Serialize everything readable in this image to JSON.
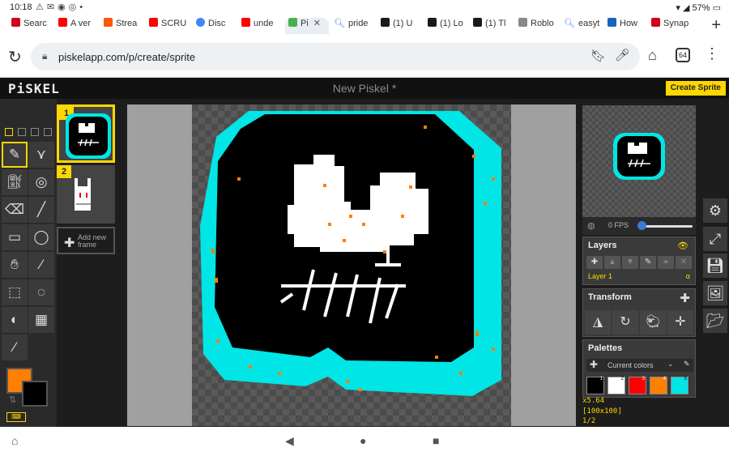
{
  "status": {
    "time": "10:18",
    "battery": "57%"
  },
  "tabs": [
    {
      "label": "Searc",
      "color": "#d0021b"
    },
    {
      "label": "A ver",
      "color": "#ff0000"
    },
    {
      "label": "Strea",
      "color": "#ff5500"
    },
    {
      "label": "SCRU",
      "color": "#ff0000"
    },
    {
      "label": "Disc",
      "color": "#4285f4"
    },
    {
      "label": "unde",
      "color": "#ff0000"
    },
    {
      "label": "Pi",
      "color": "#4caf50"
    },
    {
      "label": "pride",
      "color": "#4285f4"
    },
    {
      "label": "(1) U",
      "color": "#1a1a1a"
    },
    {
      "label": "(1) Lo",
      "color": "#1a1a1a"
    },
    {
      "label": "(1) Tl",
      "color": "#1a1a1a"
    },
    {
      "label": "Roblo",
      "color": "#888888"
    },
    {
      "label": "easyt",
      "color": "#4285f4"
    },
    {
      "label": "How",
      "color": "#1565c0"
    },
    {
      "label": "Synap",
      "color": "#d0021b"
    }
  ],
  "browser": {
    "url": "piskelapp.com/p/create/sprite",
    "tab_count": "64"
  },
  "app": {
    "logo": "PiSKEL",
    "title": "New Piskel *",
    "create_button": "Create Sprite"
  },
  "frames": [
    {
      "num": "1"
    },
    {
      "num": "2"
    }
  ],
  "add_frame_label": "Add new frame",
  "preview": {
    "fps": "0 FPS",
    "fps_value": 0
  },
  "layers": {
    "title": "Layers",
    "layer_name": "Layer 1",
    "alpha": "α"
  },
  "transform": {
    "title": "Transform"
  },
  "palettes": {
    "title": "Palettes",
    "current": "Current colors",
    "swatches": [
      {
        "num": "1",
        "color": "#000000"
      },
      {
        "num": "2",
        "color": "#ffffff"
      },
      {
        "num": "3",
        "color": "#ff0000"
      },
      {
        "num": "4",
        "color": "#ff7f00"
      },
      {
        "num": "5",
        "color": "#00e5e5"
      }
    ]
  },
  "info": {
    "zoom": "x5.64",
    "size": "[100x100]",
    "frame": "1/2"
  },
  "colors": {
    "primary": "#ff7f00",
    "secondary": "#000000",
    "accent": "#ffd700",
    "cyan": "#00e5e5"
  }
}
